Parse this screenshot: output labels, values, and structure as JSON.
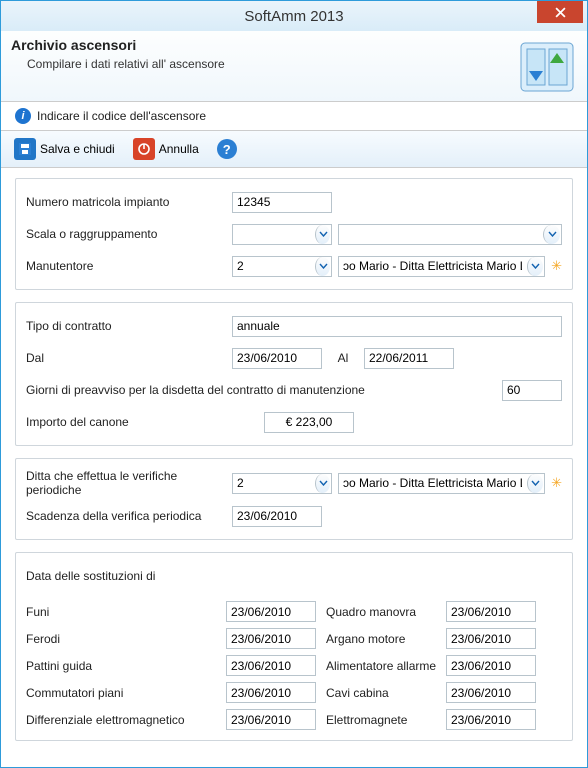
{
  "window": {
    "title": "SoftAmm 2013"
  },
  "header": {
    "title": "Archivio ascensori",
    "subtitle": "Compilare i dati relativi all' ascensore"
  },
  "info": {
    "text": "Indicare il codice dell'ascensore"
  },
  "toolbar": {
    "save_label": "Salva e chiudi",
    "cancel_label": "Annulla"
  },
  "group1": {
    "matricola_label": "Numero matricola impianto",
    "matricola_value": "12345",
    "scala_label": "Scala o raggruppamento",
    "scala_value1": "",
    "scala_value2": "",
    "manut_label": "Manutentore",
    "manut_value1": "2",
    "manut_value2": "ɔo Mario - Ditta Elettricista Mario Lampo"
  },
  "group2": {
    "tipo_label": "Tipo di contratto",
    "tipo_value": "annuale",
    "dal_label": "Dal",
    "dal_value": "23/06/2010",
    "al_label": "Al",
    "al_value": "22/06/2011",
    "preavviso_label": "Giorni di preavviso per la disdetta del contratto di manutenzione",
    "preavviso_value": "60",
    "canone_label": "Importo del canone",
    "canone_value": "€ 223,00"
  },
  "group3": {
    "ditta_label": "Ditta che effettua le verifiche periodiche",
    "ditta_value1": "2",
    "ditta_value2": "ɔo Mario - Ditta Elettricista Mario Lampo",
    "scadenza_label": "Scadenza della verifica periodica",
    "scadenza_value": "23/06/2010"
  },
  "group4": {
    "title": "Data delle sostituzioni di",
    "rows": [
      {
        "l1": "Funi",
        "v1": "23/06/2010",
        "l2": "Quadro manovra",
        "v2": "23/06/2010"
      },
      {
        "l1": "Ferodi",
        "v1": "23/06/2010",
        "l2": "Argano motore",
        "v2": "23/06/2010"
      },
      {
        "l1": "Pattini guida",
        "v1": "23/06/2010",
        "l2": "Alimentatore allarme",
        "v2": "23/06/2010"
      },
      {
        "l1": "Commutatori piani",
        "v1": "23/06/2010",
        "l2": "Cavi cabina",
        "v2": "23/06/2010"
      },
      {
        "l1": "Differenziale elettromagnetico",
        "v1": "23/06/2010",
        "l2": "Elettromagnete",
        "v2": "23/06/2010"
      }
    ]
  }
}
